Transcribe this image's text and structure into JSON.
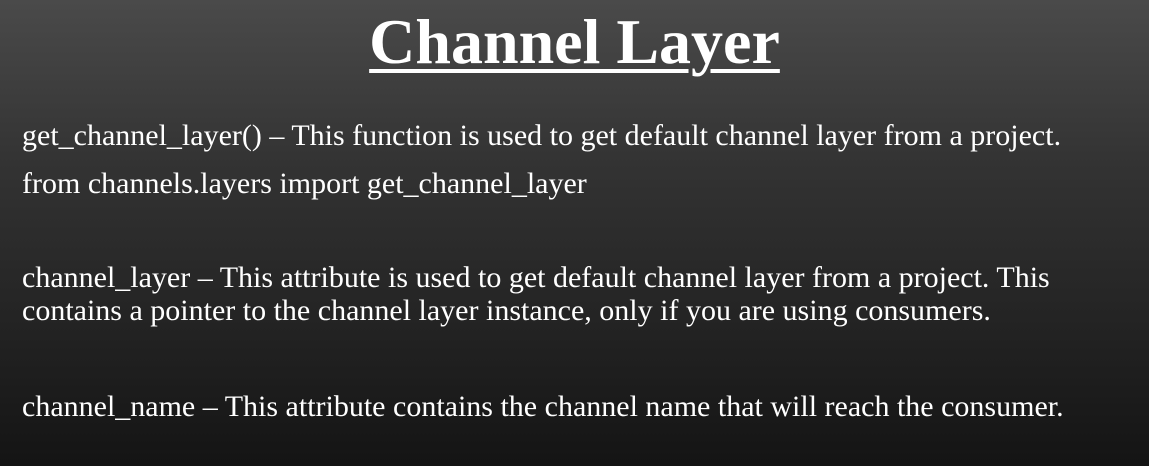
{
  "slide": {
    "title": "Channel Layer",
    "lines": [
      "get_channel_layer() –  This function is used to get default channel layer from a project.",
      "from channels.layers import get_channel_layer",
      "channel_layer – This attribute is used to get default channel layer from a project. This",
      "contains a pointer to the channel layer instance, only if you are using consumers.",
      "channel_name – This attribute contains the channel name that will reach the consumer."
    ]
  },
  "colors": {
    "background_top": "#4a4a4a",
    "background_bottom": "#141414",
    "text": "#ffffff"
  }
}
